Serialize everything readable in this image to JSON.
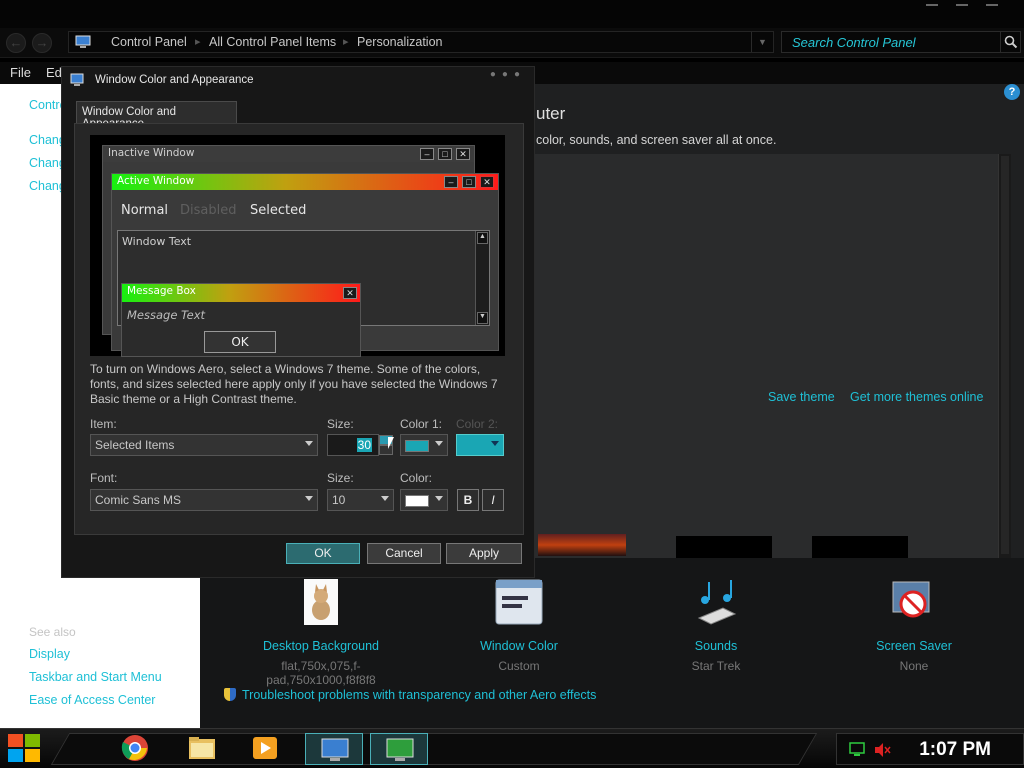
{
  "address": {
    "crumbs": [
      "Control Panel",
      "All Control Panel Items",
      "Personalization"
    ],
    "search_placeholder": "Search Control Panel"
  },
  "menubar": {
    "file": "File",
    "edit": "Ed"
  },
  "left_pane": {
    "links": [
      "Contro",
      "Chang",
      "Chang",
      "Chang"
    ],
    "see_also": "See also",
    "see_also_links": [
      "Display",
      "Taskbar and Start Menu",
      "Ease of Access Center"
    ]
  },
  "main": {
    "title": "uter",
    "description": "color, sounds, and screen saver all at once.",
    "help": "?",
    "save_theme": "Save theme",
    "more_themes": "Get more themes online",
    "items": [
      {
        "label": "Desktop Background",
        "sub": "flat,750x,075,f-pad,750x1000,f8f8f8",
        "icon": "cat-picture-icon"
      },
      {
        "label": "Window Color",
        "sub": "Custom",
        "icon": "window-color-icon"
      },
      {
        "label": "Sounds",
        "sub": "Star Trek",
        "icon": "music-notes-icon"
      },
      {
        "label": "Screen Saver",
        "sub": "None",
        "icon": "screen-saver-icon"
      }
    ],
    "troubleshoot": "Troubleshoot problems with transparency and other Aero effects"
  },
  "dialog": {
    "title": "Window Color and Appearance",
    "tab": "Window Color and Appearance",
    "preview": {
      "inactive_window": "Inactive Window",
      "active_window": "Active Window",
      "menu_normal": "Normal",
      "menu_disabled": "Disabled",
      "menu_selected": "Selected",
      "window_text": "Window Text",
      "message_box": "Message Box",
      "message_text": "Message Text",
      "ok": "OK"
    },
    "info": "To turn on Windows Aero, select a Windows 7 theme.  Some of the colors, fonts, and sizes selected here apply only if you have selected the Windows 7 Basic theme or a High Contrast theme.",
    "item_label": "Item:",
    "item_value": "Selected Items",
    "size_label": "Size:",
    "size_value": "30",
    "color1_label": "Color 1:",
    "color2_label": "Color 2:",
    "font_label": "Font:",
    "font_value": "Comic Sans MS",
    "font_size_label": "Size:",
    "font_size_value": "10",
    "font_color_label": "Color:",
    "bold": "B",
    "italic": "I",
    "ok": "OK",
    "cancel": "Cancel",
    "apply": "Apply",
    "colors": {
      "color1": "#1aa6b4",
      "color2": "#1aa6b4",
      "font_color": "#ffffff"
    }
  },
  "taskbar": {
    "clock": "1:07 PM",
    "apps": [
      "chrome-icon",
      "folder-icon",
      "media-player-icon",
      "control-panel-icon",
      "personalization-icon"
    ]
  }
}
